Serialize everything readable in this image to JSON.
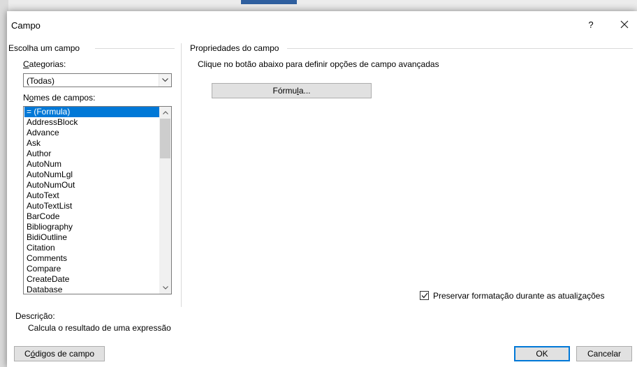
{
  "dialog": {
    "title": "Campo",
    "help_label": "?",
    "close_label": "✕"
  },
  "left": {
    "section_title": "Escolha um campo",
    "categories_label_prefix": "",
    "categories_label_accel": "C",
    "categories_label_rest": "ategorias:",
    "categories_value": "(Todas)",
    "names_label_prefix": "N",
    "names_label_accel": "o",
    "names_label_rest": "mes de campos:",
    "field_names": [
      "= (Formula)",
      "AddressBlock",
      "Advance",
      "Ask",
      "Author",
      "AutoNum",
      "AutoNumLgl",
      "AutoNumOut",
      "AutoText",
      "AutoTextList",
      "BarCode",
      "Bibliography",
      "BidiOutline",
      "Citation",
      "Comments",
      "Compare",
      "CreateDate",
      "Database"
    ],
    "selected_index": 0,
    "description_label": "Descrição:",
    "description_text": "Calcula o resultado de uma expressão"
  },
  "right": {
    "section_title": "Propriedades do campo",
    "hint": "Clique no botão abaixo para definir opções de campo avançadas",
    "formula_prefix": "Fórmu",
    "formula_accel": "l",
    "formula_rest": "a...",
    "preserve_prefix": "Preservar formatação durante as atuali",
    "preserve_accel": "z",
    "preserve_rest": "ações",
    "preserve_checked": true
  },
  "footer": {
    "codes_prefix": "C",
    "codes_accel": "ó",
    "codes_rest": "digos de campo",
    "ok_label": "OK",
    "cancel_label": "Cancelar"
  }
}
